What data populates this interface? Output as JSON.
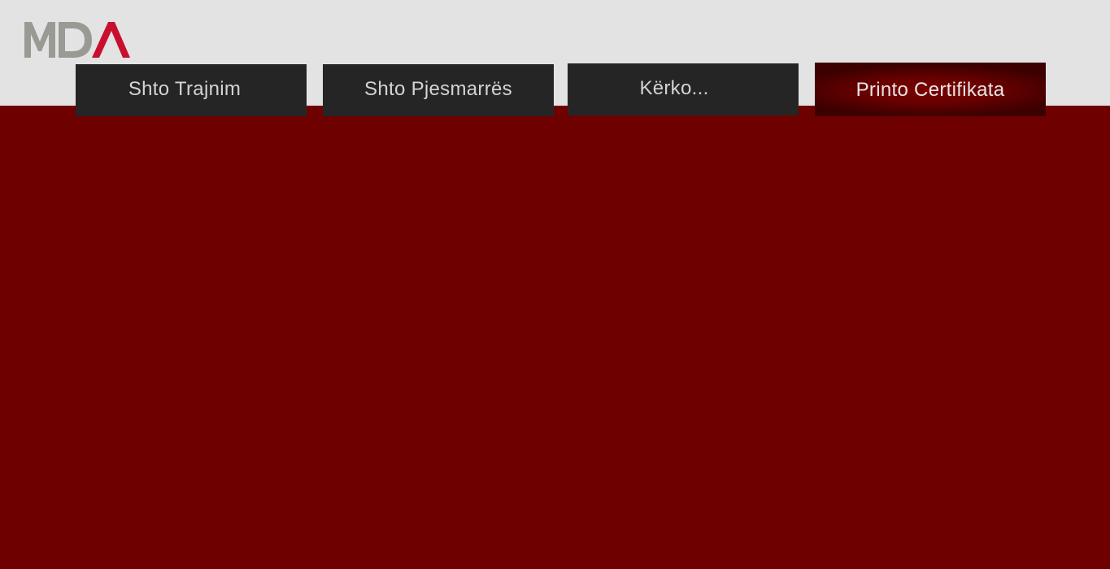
{
  "logo": {
    "text": "MDA",
    "colors": {
      "gray": "#9a9a95",
      "red": "#c8102e"
    }
  },
  "nav": {
    "items": [
      {
        "label": "Shto Trajnim"
      },
      {
        "label": "Shto Pjesmarrës"
      },
      {
        "label": "Kërko..."
      },
      {
        "label": "Printo Certifikata",
        "active": true
      }
    ]
  },
  "colors": {
    "header_bg": "#e3e3e3",
    "main_bg": "#6e0000",
    "button_bg": "#252525",
    "button_text": "#d4d4d4"
  }
}
